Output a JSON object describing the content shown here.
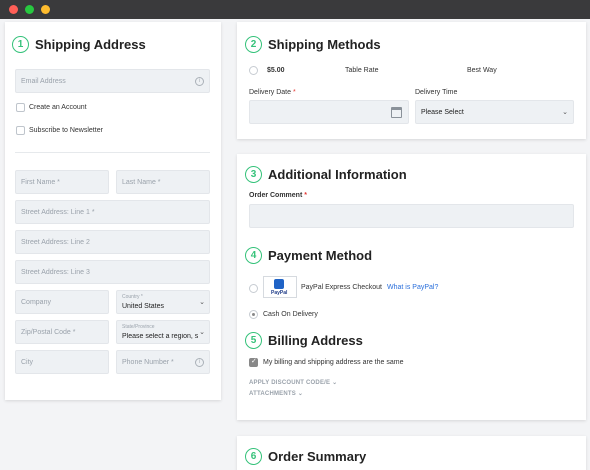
{
  "window": {
    "dots": [
      {
        "color": "#ff5f57"
      },
      {
        "color": "#28c840"
      },
      {
        "color": "#febc2e"
      }
    ]
  },
  "shipping_address": {
    "step": "1",
    "title": "Shipping Address",
    "email_placeholder": "Email Address",
    "create_account_label": "Create an Account",
    "subscribe_label": "Subscribe to Newsletter",
    "first_name": "First Name *",
    "last_name": "Last Name *",
    "street1": "Street Address: Line 1 *",
    "street2": "Street Address: Line 2",
    "street3": "Street Address: Line 3",
    "company": "Company",
    "country_label": "Country *",
    "country_value": "United States",
    "zip": "Zip/Postal Code *",
    "state_label": "State/Province",
    "state_value": "Please select a region, s",
    "city": "City",
    "phone": "Phone Number *"
  },
  "shipping_methods": {
    "step": "2",
    "title": "Shipping Methods",
    "rate_price": "$5.00",
    "rate_name": "Table Rate",
    "rate_carrier": "Best Way",
    "delivery_date_label": "Delivery Date",
    "required_mark": "*",
    "delivery_time_label": "Delivery Time",
    "delivery_time_value": "Please Select"
  },
  "additional_info": {
    "step": "3",
    "title": "Additional Information",
    "order_comment_label": "Order Comment",
    "required_mark": "*"
  },
  "payment_method": {
    "step": "4",
    "title": "Payment Method",
    "paypal_logo": "PayPal",
    "paypal_label": "PayPal Express Checkout",
    "paypal_link": "What is PayPal?",
    "cod_label": "Cash On Delivery"
  },
  "billing_address": {
    "step": "5",
    "title": "Billing Address",
    "same_label": "My billing and shipping address are the same",
    "discount_link": "APPLY DISCOUNT CODE/E",
    "attachments_link": "ATTACHMENTS"
  },
  "order_summary": {
    "step": "6",
    "title": "Order Summary"
  },
  "colors": {
    "accent": "#35c27a",
    "link": "#2a6fdb",
    "required": "#e53935"
  }
}
